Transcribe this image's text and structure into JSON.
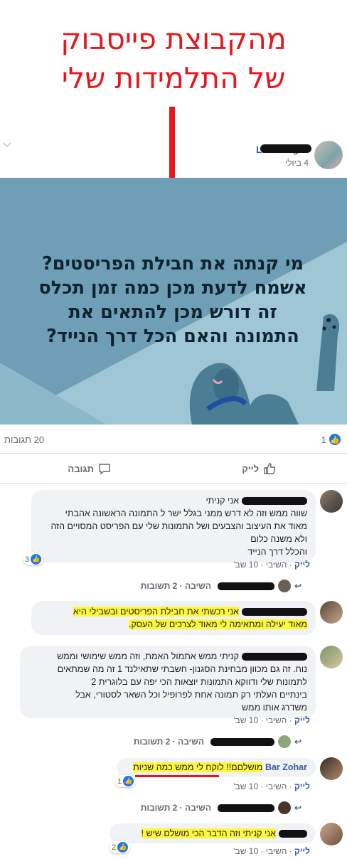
{
  "headline": {
    "line1": "מהקבוצת פייסבוק",
    "line2": "של התלמידות שלי"
  },
  "colors": {
    "accent_red": "#e8161b",
    "facebook_blue": "#1877f2",
    "link_blue": "#385898",
    "highlight": "#fff83a"
  },
  "post": {
    "author": "Liron Yogev",
    "date": "4 ביולי",
    "image_text": [
      "מי קנתה את חבילת הפריסטים?",
      "אשמח לדעת מכן כמה זמן תכלס",
      "זה דורש מכן להתאים את",
      "התמונה והאם הכל דרך הנייד?"
    ],
    "comments_count": "20 תגובות",
    "likes_count": "1",
    "like_label": "לייק",
    "comment_label": "תגובה",
    "options_icon": "chevron-down-icon"
  },
  "comments": [
    {
      "lines": [
        "אני קניתי",
        "שווה ממש וזה לא דרש ממני בגלל ישר ל התמונה הראשונה אהבתי",
        "מאוד את העיצוב והצבעים ושל התמונות שלי עם הפריסט המסויים הזה",
        "ולא משנה כלום",
        "והכלל דרך הנייד"
      ],
      "like": "לייק",
      "reply": "השיבי",
      "time": "10 שב'",
      "reactions": "3",
      "replies_text": "השיבה · 2 תשובות"
    },
    {
      "text": "אני רכשתי את חבילת הפריסטים ובשבילי היא",
      "text2": "מאוד יעילה ומתאימה לי מאוד לצרכים של העסק."
    },
    {
      "lines": [
        "קניתי ממש אתמול האמת, וזה ממש שימושי וממש",
        "נוח. זה גם מכוון מבחינת הסגנון- חשבתי שתאילנד 1 זה מה שמתאים",
        "לתמונות שלי ודווקא התמונות יוצאות הכי יפה עם בלוגרית 2",
        "בינתיים העלתי רק תמונה אחת לפרופיל וכל השאר לסטורי, אבל",
        "משדרג אותו ממש"
      ],
      "like": "לייק",
      "reply": "השיבי",
      "time": "10 שב'",
      "replies_text": "השיבה · 2 תשובות"
    },
    {
      "name": "Bar Zohar",
      "text": "מושלםם!! לוקח לי ממש כמה שניות",
      "like": "לייק",
      "reply": "השיבי",
      "time": "10 שב'",
      "reactions": "1",
      "replies_text": "השיבה · 2 תשובות"
    },
    {
      "text": "אני קניתי וזה הדבר הכי מושלם שיש !",
      "like": "לייק",
      "reply": "השיבי",
      "time": "10 שב'",
      "reactions": "2"
    }
  ]
}
